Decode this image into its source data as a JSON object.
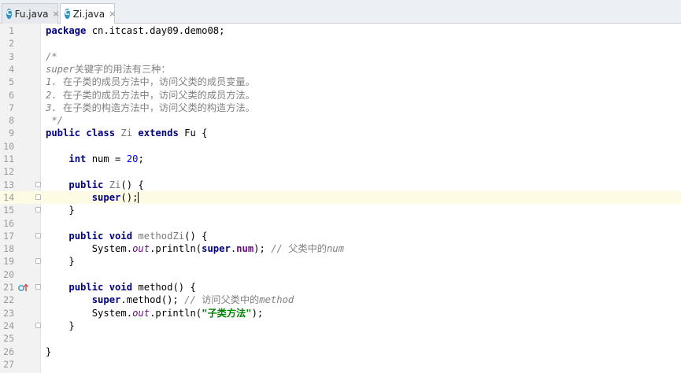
{
  "tabs": [
    {
      "label": "Fu.java",
      "close": "×",
      "icon": "class-icon",
      "icon_glyph": "C"
    },
    {
      "label": "Zi.java",
      "close": "×",
      "icon": "class-icon",
      "icon_glyph": "C"
    }
  ],
  "editor": {
    "lines": [
      {
        "n": "1",
        "tokens": [
          [
            "kw",
            "package"
          ],
          [
            "t",
            " cn.itcast.day09.demo08;"
          ]
        ]
      },
      {
        "n": "2",
        "tokens": []
      },
      {
        "n": "3",
        "tokens": [
          [
            "cm",
            "/*"
          ]
        ]
      },
      {
        "n": "4",
        "tokens": [
          [
            "cm",
            "super"
          ],
          [
            "cmcn",
            "关键字的用法有三种："
          ]
        ]
      },
      {
        "n": "5",
        "tokens": [
          [
            "cm",
            "1. "
          ],
          [
            "cmcn",
            "在子类的成员方法中，访问父类的成员变量。"
          ]
        ]
      },
      {
        "n": "6",
        "tokens": [
          [
            "cm",
            "2. "
          ],
          [
            "cmcn",
            "在子类的成员方法中，访问父类的成员方法。"
          ]
        ]
      },
      {
        "n": "7",
        "tokens": [
          [
            "cm",
            "3. "
          ],
          [
            "cmcn",
            "在子类的构造方法中，访问父类的构造方法。"
          ]
        ]
      },
      {
        "n": "8",
        "tokens": [
          [
            "cm",
            " */"
          ]
        ]
      },
      {
        "n": "9",
        "tokens": [
          [
            "kw",
            "public class "
          ],
          [
            "decl",
            "Zi"
          ],
          [
            "kw",
            " extends"
          ],
          [
            "t",
            " Fu {"
          ]
        ]
      },
      {
        "n": "10",
        "tokens": []
      },
      {
        "n": "11",
        "tokens": [
          [
            "t",
            "    "
          ],
          [
            "kw",
            "int"
          ],
          [
            "t",
            " num = "
          ],
          [
            "num",
            "20"
          ],
          [
            "t",
            ";"
          ]
        ]
      },
      {
        "n": "12",
        "tokens": []
      },
      {
        "n": "13",
        "tokens": [
          [
            "t",
            "    "
          ],
          [
            "kw",
            "public "
          ],
          [
            "decl",
            "Zi"
          ],
          [
            "t",
            "() {"
          ]
        ]
      },
      {
        "n": "14",
        "tokens": [
          [
            "t",
            "        "
          ],
          [
            "kw",
            "super"
          ],
          [
            "t",
            "();"
          ],
          [
            "caret",
            ""
          ]
        ]
      },
      {
        "n": "15",
        "tokens": [
          [
            "t",
            "    }"
          ]
        ]
      },
      {
        "n": "16",
        "tokens": []
      },
      {
        "n": "17",
        "tokens": [
          [
            "t",
            "    "
          ],
          [
            "kw",
            "public void "
          ],
          [
            "decl",
            "methodZi"
          ],
          [
            "t",
            "() {"
          ]
        ]
      },
      {
        "n": "18",
        "tokens": [
          [
            "t",
            "        System."
          ],
          [
            "fld",
            "out"
          ],
          [
            "t",
            ".println("
          ],
          [
            "kw",
            "super"
          ],
          [
            "t",
            "."
          ],
          [
            "fldb",
            "num"
          ],
          [
            "t",
            "); "
          ],
          [
            "cm",
            "// "
          ],
          [
            "cmcn",
            "父类中的"
          ],
          [
            "cm",
            "num"
          ]
        ]
      },
      {
        "n": "19",
        "tokens": [
          [
            "t",
            "    }"
          ]
        ]
      },
      {
        "n": "20",
        "tokens": []
      },
      {
        "n": "21",
        "tokens": [
          [
            "t",
            "    "
          ],
          [
            "kw",
            "public void "
          ],
          [
            "t",
            "method() {"
          ]
        ]
      },
      {
        "n": "22",
        "tokens": [
          [
            "t",
            "        "
          ],
          [
            "kw",
            "super"
          ],
          [
            "t",
            ".method(); "
          ],
          [
            "cm",
            "// "
          ],
          [
            "cmcn",
            "访问父类中的"
          ],
          [
            "cm",
            "method"
          ]
        ]
      },
      {
        "n": "23",
        "tokens": [
          [
            "t",
            "        System."
          ],
          [
            "fld",
            "out"
          ],
          [
            "t",
            ".println("
          ],
          [
            "str",
            "\"子类方法\""
          ],
          [
            "t",
            ");"
          ]
        ]
      },
      {
        "n": "24",
        "tokens": [
          [
            "t",
            "    }"
          ]
        ]
      },
      {
        "n": "25",
        "tokens": []
      },
      {
        "n": "26",
        "tokens": [
          [
            "t",
            "}"
          ]
        ]
      },
      {
        "n": "27",
        "tokens": []
      }
    ],
    "current_line": "14",
    "fold_lines": [
      "13",
      "14",
      "15",
      "17",
      "19",
      "21",
      "24"
    ],
    "override_line": "21"
  },
  "colors": {
    "keyword": "#000080",
    "comment": "#808080",
    "number": "#0000ff",
    "field": "#660e7a",
    "string": "#008000",
    "current_line_bg": "#fdfbe3"
  }
}
